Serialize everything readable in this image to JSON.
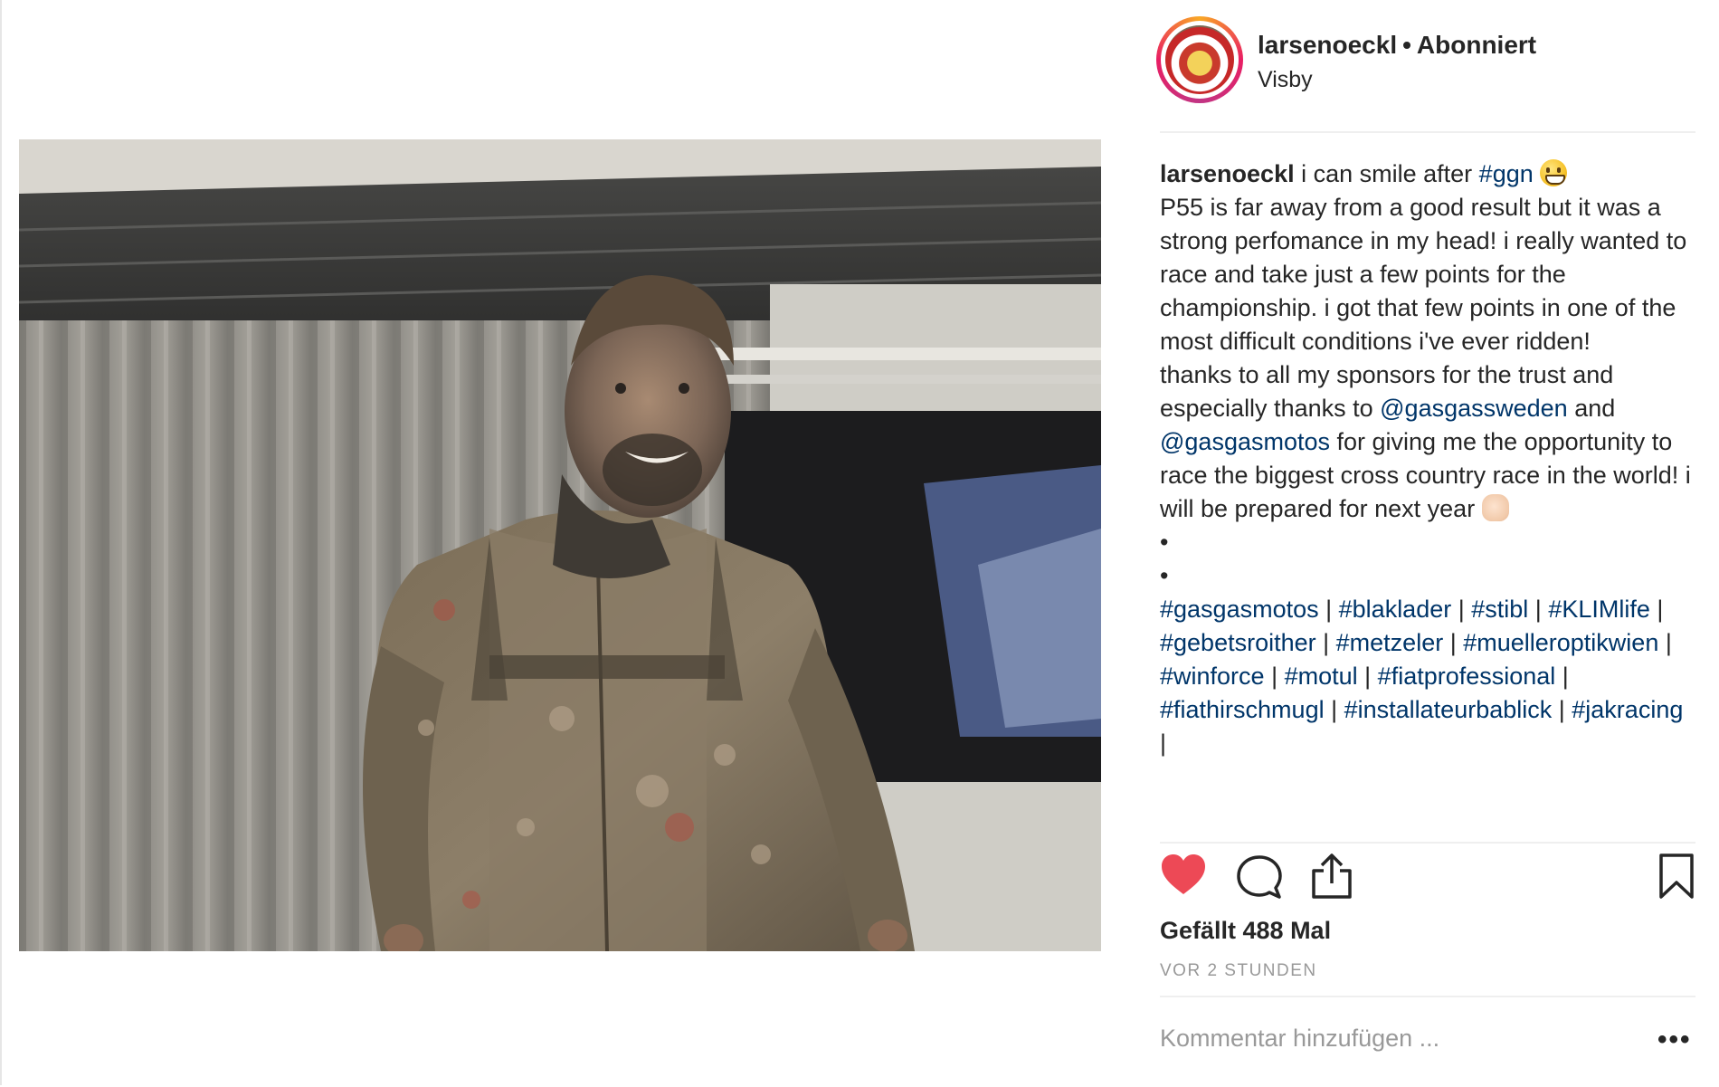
{
  "post": {
    "username": "larsenoeckl",
    "separator": "•",
    "follow_status": "Abonniert",
    "location": "Visby",
    "caption": {
      "username": "larsenoeckl",
      "line1_text": " i can smile after ",
      "line1_tag": "#ggn",
      "paragraph1": "P55 is far away from a good result but it was a strong perfomance in my head! i really wanted to race and take just a few points for the championship. i got that few points in one of the most difficult conditions i've ever ridden!",
      "p2_text_a": "thanks to all my sponsors for the trust and especially thanks to ",
      "p2_mention1": "@gasgassweden",
      "p2_text_b": " and ",
      "p2_mention2": "@gasgasmotos",
      "p2_text_c": " for giving me the opportunity to race the biggest cross country race in the world! i will be prepared for next year ",
      "bullet1": "•",
      "bullet2": "•",
      "hashtags": [
        "#gasgasmotos",
        "#blaklader",
        "#stibl",
        "#KLIMlife",
        "#gebetsroither",
        "#metzeler",
        "#muelleroptikwien",
        "#winforce",
        "#motul",
        "#fiatprofessional",
        "#fiathirschmugl",
        "#installateurbablick",
        "#jakracing"
      ],
      "hashtag_separator": " | "
    },
    "likes_text": "Gefällt 488 Mal",
    "time_text": "VOR 2 STUNDEN",
    "comment_placeholder": "Kommentar hinzufügen ...",
    "more_label": "•••",
    "liked": true,
    "accent_colors": {
      "like": "#ed4956",
      "tag": "#003569",
      "muted": "#999999"
    },
    "icons": [
      "heart-icon",
      "comment-icon",
      "share-icon",
      "bookmark-icon",
      "more-options-icon"
    ]
  }
}
